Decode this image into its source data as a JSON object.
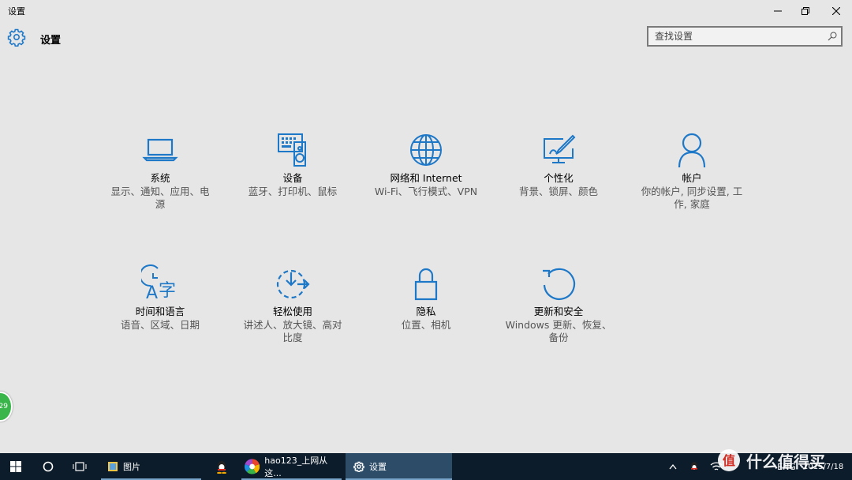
{
  "window": {
    "title": "设置"
  },
  "header": {
    "title": "设置"
  },
  "search": {
    "placeholder": "查找设置"
  },
  "colors": {
    "accent": "#1e78c8",
    "taskbar": "#0d1c2a",
    "background": "#e6e6e6"
  },
  "categories": [
    {
      "icon": "laptop-icon",
      "label": "系统",
      "desc": "显示、通知、应用、电源"
    },
    {
      "icon": "keyboard-speaker-icon",
      "label": "设备",
      "desc": "蓝牙、打印机、鼠标"
    },
    {
      "icon": "globe-icon",
      "label": "网络和 Internet",
      "desc": "Wi-Fi、飞行模式、VPN"
    },
    {
      "icon": "paint-brush-icon",
      "label": "个性化",
      "desc": "背景、锁屏、颜色"
    },
    {
      "icon": "person-icon",
      "label": "帐户",
      "desc": "你的帐户, 同步设置, 工作, 家庭"
    },
    {
      "icon": "language-icon",
      "label": "时间和语言",
      "desc": "语音、区域、日期"
    },
    {
      "icon": "ease-of-access-icon",
      "label": "轻松使用",
      "desc": "讲述人、放大镜、高对比度"
    },
    {
      "icon": "lock-icon",
      "label": "隐私",
      "desc": "位置、相机"
    },
    {
      "icon": "refresh-icon",
      "label": "更新和安全",
      "desc": "Windows 更新、恢复、备份"
    }
  ],
  "floating": {
    "badge": "29"
  },
  "taskbar": {
    "apps": [
      {
        "label": "图片",
        "icon": "photos-icon"
      },
      {
        "label": "",
        "icon": "qq-penguin-icon"
      },
      {
        "label": "hao123_上网从这...",
        "icon": "browser-icon"
      },
      {
        "label": "设置",
        "icon": "gear-icon"
      }
    ],
    "tray_lang": "ENG",
    "clock_date": "2015/7/18"
  },
  "watermark": {
    "text": "什么值得买"
  }
}
